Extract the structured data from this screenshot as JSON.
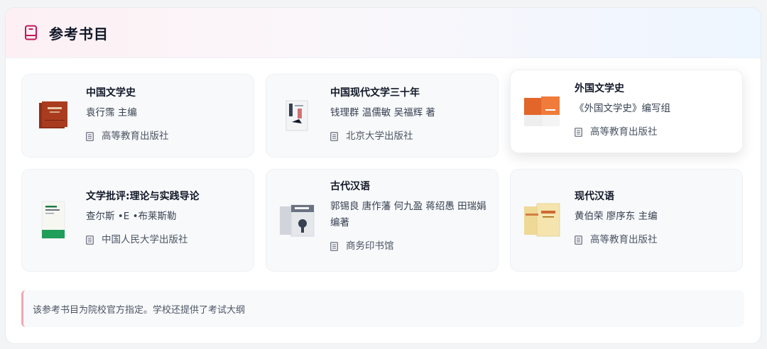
{
  "header": {
    "title": "参考书目",
    "icon": "book-icon"
  },
  "books": [
    {
      "title": "中国文学史",
      "author": "袁行霈 主编",
      "publisher": "高等教育出版社",
      "cover_color": "#a13b1f"
    },
    {
      "title": "中国现代文学三十年",
      "author": "钱理群 温儒敏 吴福辉 著",
      "publisher": "北京大学出版社",
      "cover_color": "#e5e7eb"
    },
    {
      "title": "外国文学史",
      "author": "《外国文学史》编写组",
      "publisher": "高等教育出版社",
      "cover_color": "#f07b3b"
    },
    {
      "title": "文学批评:理论与实践导论",
      "author": "查尔斯 •E •布莱斯勒",
      "publisher": "中国人民大学出版社",
      "cover_color": "#1f9e5a"
    },
    {
      "title": "古代汉语",
      "author": "郭锡良 唐作藩 何九盈 蒋绍愚 田瑞娟 编著",
      "publisher": "商务印书馆",
      "cover_color": "#9ca3af"
    },
    {
      "title": "现代汉语",
      "author": "黄伯荣 廖序东 主编",
      "publisher": "高等教育出版社",
      "cover_color": "#f2dfa1"
    }
  ],
  "note": {
    "text": "该参考书目为院校官方指定。学校还提供了考试大纲"
  }
}
